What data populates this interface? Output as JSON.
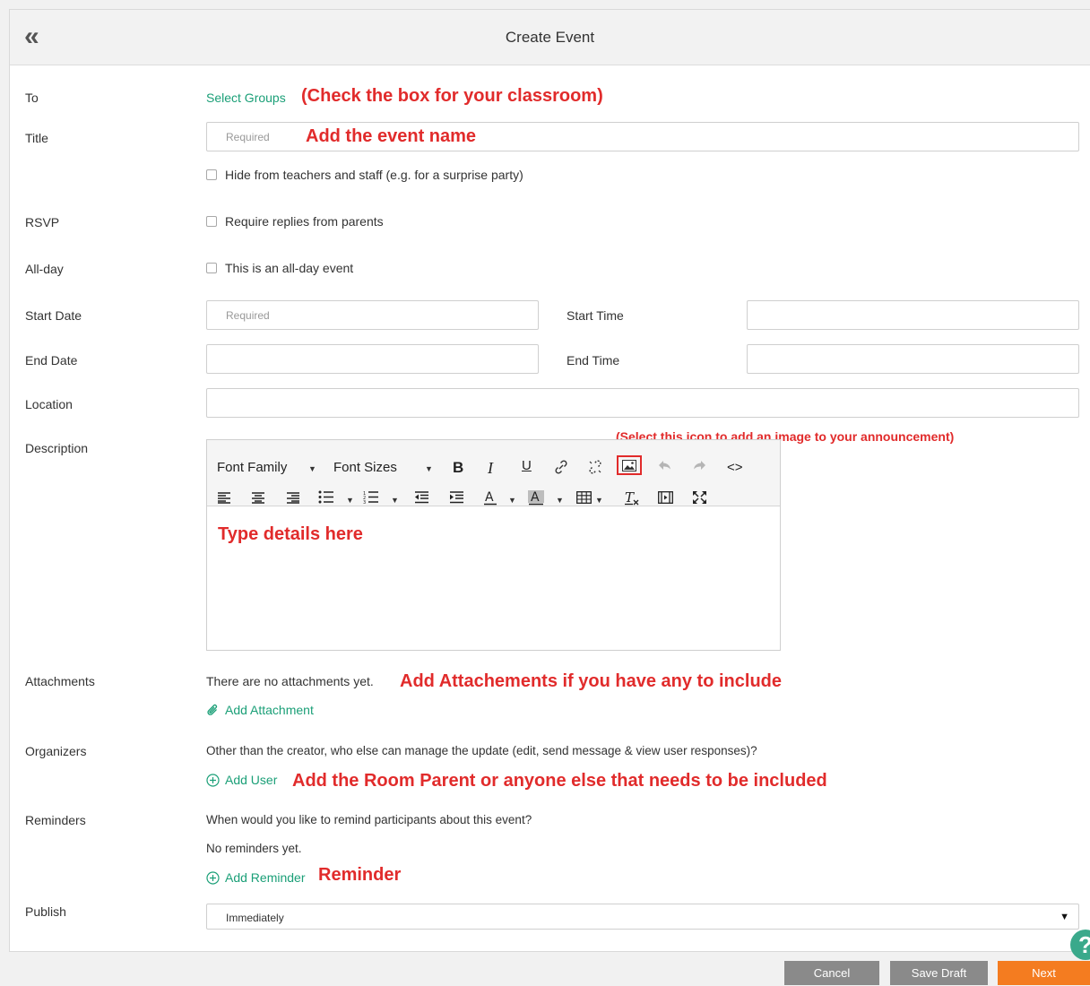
{
  "header": {
    "title": "Create Event",
    "back_icon": "«"
  },
  "to": {
    "label": "To",
    "link": "Select Groups",
    "annotation": "(Check the box for your classroom)"
  },
  "title_row": {
    "label": "Title",
    "placeholder": "Required",
    "annotation": "Add the event name"
  },
  "hide_checkbox": {
    "text": "Hide from teachers and staff (e.g. for a surprise party)"
  },
  "rsvp": {
    "label": "RSVP",
    "text": "Require replies from parents"
  },
  "allday": {
    "label": "All-day",
    "text": "This is an all-day event"
  },
  "start": {
    "label": "Start Date",
    "placeholder": "Required",
    "time_label": "Start Time"
  },
  "end": {
    "label": "End Date",
    "time_label": "End Time"
  },
  "location": {
    "label": "Location"
  },
  "description": {
    "label": "Description",
    "font_family": "Font Family",
    "font_sizes": "Font Sizes",
    "bold": "B",
    "italic": "I",
    "underline": "U",
    "code": "<>",
    "image_annotation": "(Select this icon to add an image to your announcement)",
    "body_annotation": "Type details here"
  },
  "attachments": {
    "label": "Attachments",
    "text": "There are no attachments yet.",
    "annotation": "Add Attachements if you have any to include",
    "link": "Add Attachment"
  },
  "organizers": {
    "label": "Organizers",
    "text": "Other than the creator, who else can manage the update (edit, send message & view user responses)?",
    "link": "Add User",
    "annotation": "Add the Room Parent or anyone else that needs to be included"
  },
  "reminders": {
    "label": "Reminders",
    "question": "When would you like to remind participants about this event?",
    "empty": "No reminders yet.",
    "link": "Add Reminder",
    "annotation": "Reminder"
  },
  "publish": {
    "label": "Publish",
    "value": "Immediately"
  },
  "buttons": {
    "cancel": "Cancel",
    "save_draft": "Save Draft",
    "next": "Next"
  },
  "help_icon": "?",
  "colors": {
    "accent": "#1a9f77",
    "annotation": "#e12b2b",
    "next": "#f47c20",
    "gray_button": "#8a8a8a"
  }
}
